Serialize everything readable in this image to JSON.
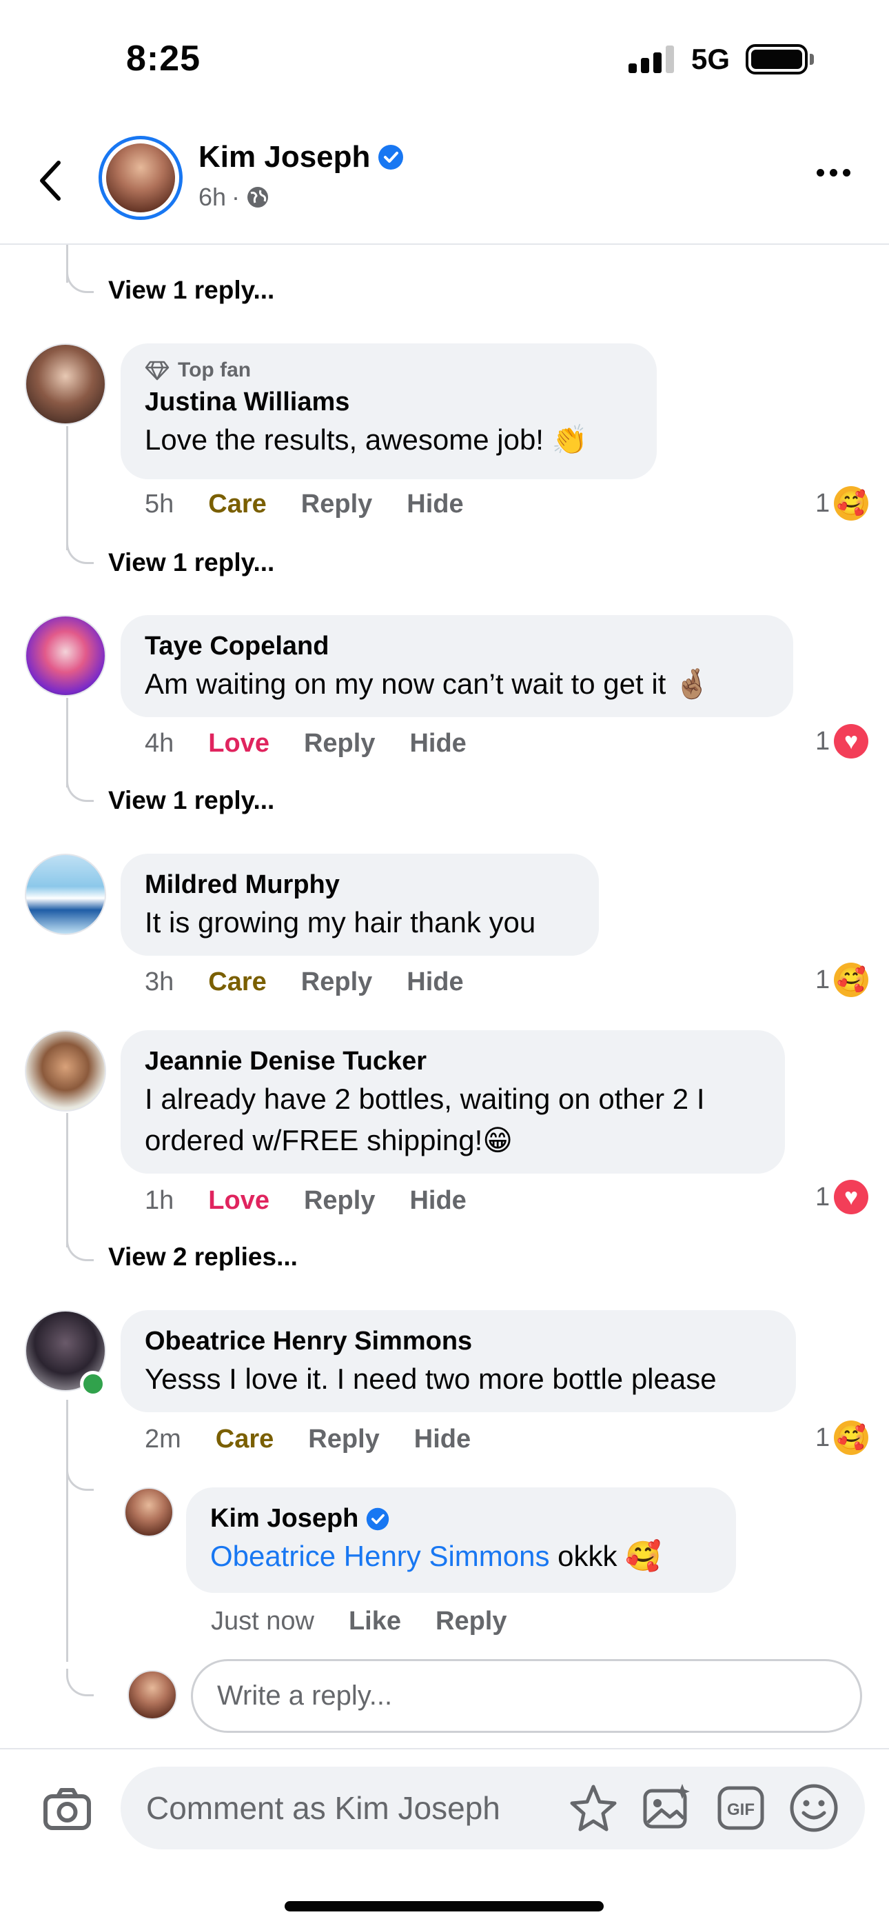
{
  "status": {
    "time": "8:25",
    "network": "5G"
  },
  "header": {
    "name": "Kim Joseph",
    "time": "6h",
    "separator": "·"
  },
  "comments": [
    {
      "view_replies": "View 1 reply..."
    },
    {
      "badge": "Top fan",
      "author": "Justina Williams",
      "text": "Love the results, awesome job! 👏",
      "time": "5h",
      "reaction_label": "Care",
      "reply": "Reply",
      "hide": "Hide",
      "reaction_count": "1",
      "reaction_emoji": "🥰",
      "view_replies": "View 1 reply..."
    },
    {
      "author": "Taye Copeland",
      "text": "Am waiting on my now can’t wait to get it 🤞🏽",
      "time": "4h",
      "reaction_label": "Love",
      "reply": "Reply",
      "hide": "Hide",
      "reaction_count": "1",
      "reaction_emoji": "♥",
      "view_replies": "View 1 reply..."
    },
    {
      "author": "Mildred Murphy",
      "text": "It is growing my hair thank you",
      "time": "3h",
      "reaction_label": "Care",
      "reply": "Reply",
      "hide": "Hide",
      "reaction_count": "1",
      "reaction_emoji": "🥰"
    },
    {
      "author": "Jeannie Denise Tucker",
      "text_line1": "I already have 2 bottles, waiting on other 2 I",
      "text_line2": "ordered w/FREE shipping!😁",
      "time": "1h",
      "reaction_label": "Love",
      "reply": "Reply",
      "hide": "Hide",
      "reaction_count": "1",
      "reaction_emoji": "♥",
      "view_replies": "View 2 replies..."
    },
    {
      "author": "Obeatrice Henry Simmons",
      "text": "Yesss I love it. I need two more bottle please",
      "time": "2m",
      "reaction_label": "Care",
      "reply": "Reply",
      "hide": "Hide",
      "reaction_count": "1",
      "reaction_emoji": "🥰"
    }
  ],
  "owner_reply": {
    "author": "Kim Joseph",
    "mention": "Obeatrice Henry Simmons",
    "text": " okkk 🥰",
    "time": "Just now",
    "like": "Like",
    "reply": "Reply"
  },
  "reply_input": {
    "placeholder": "Write a reply..."
  },
  "composer": {
    "placeholder": "Comment as Kim Joseph"
  },
  "colors": {
    "accent": "#1877f2",
    "care": "#7a5f00",
    "love": "#e0245e",
    "bubble": "#f0f2f5"
  }
}
